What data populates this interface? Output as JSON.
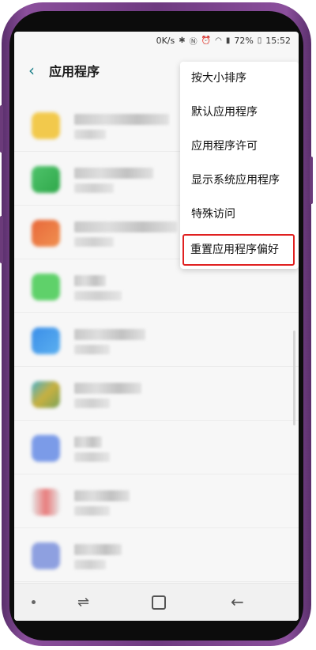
{
  "status_bar": {
    "speed": "0K/s",
    "signal_icons": [
      "bluetooth-icon",
      "nfc-icon",
      "alarm-icon",
      "wifi-icon",
      "signal-icon"
    ],
    "battery": "72%",
    "time": "15:52"
  },
  "header": {
    "back_icon": "back-arrow-icon",
    "title": "应用程序"
  },
  "app_list": {
    "note": "app names and details blurred/pixelated in screenshot",
    "icon_colors": [
      "#f2c94c",
      "#4fc36b",
      "#e8683a",
      "#5fd16a",
      "#3a8ee8",
      "#7aa35a",
      "#7b9be8",
      "#e87b7b",
      "#8ea0e0"
    ]
  },
  "overflow_menu": {
    "items": [
      "按大小排序",
      "默认应用程序",
      "应用程序许可",
      "显示系统应用程序",
      "特殊访问",
      "重置应用程序偏好"
    ],
    "highlighted_index": 5,
    "highlight_color": "#e02020"
  },
  "nav_bar": {
    "icons": [
      "dot-icon",
      "recent-apps-icon",
      "home-icon",
      "back-icon"
    ]
  }
}
